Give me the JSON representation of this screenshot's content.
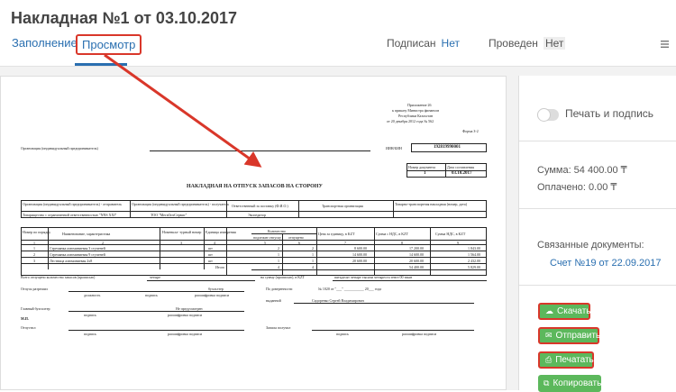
{
  "header": {
    "title": "Накладная №1 от 03.10.2017",
    "tabs": {
      "fill": "Заполнение",
      "view": "Просмотр"
    },
    "signed_label": "Подписан",
    "signed_value": "Нет",
    "posted_label": "Проведен",
    "posted_value": "Нет"
  },
  "side": {
    "print_sign_label": "Печать и подпись",
    "sum_text": "Сумма: 54 400.00 ₸",
    "paid_text": "Оплачено: 0.00 ₸",
    "linked_docs_label": "Связанные документы:",
    "linked_doc": "Счет №19 от 22.09.2017",
    "buttons": {
      "download": "Скачать",
      "send": "Отправить",
      "print": "Печатать",
      "copy": "Копировать"
    }
  },
  "doc": {
    "appendix_l1": "Приложение 26",
    "appendix_l2": "к приказу Министра финансов",
    "appendix_l3": "Республики Казахстан",
    "appendix_l4": "от 20 декабря 2012 года № 562",
    "form": "Форма З-2",
    "org_label": "Организация (индивидуальный предприниматель)",
    "iin_label": "ИИН/БИН",
    "iin_value": "192819990001",
    "doc_num_label": "Номер документа",
    "doc_date_label": "Дата составления",
    "doc_num": "1",
    "doc_date": "03.10.2017",
    "doc_title": "НАКЛАДНАЯ НА ОТПУСК ЗАПАСОВ НА СТОРОНУ",
    "h_sender": "Организация (индивидуальный предприниматель) - отправитель",
    "h_receiver": "Организация (индивидуальный предприниматель) - получатель",
    "h_responsible": "Ответственный за поставку (Ф.И.О.)",
    "h_transport": "Транспортная организация",
    "h_waybill": "Товарно-транспортная накладная (номер, дата)",
    "sender": "Товарищество с ограниченной ответственностью \"NNS XXI\"",
    "receiver": "ТОО \"МегаОптСервис\"",
    "responsible": "Экспедитор",
    "col_num": "Номер по порядку",
    "col_name": "Наименование, характеристика",
    "col_nomen": "Номенкла- турный номер",
    "col_unit": "Единица измерения",
    "col_qty": "Количество",
    "col_qty_release": "подлежит отпуску",
    "col_qty_released": "отпущено",
    "col_price": "Цена за единицу, в KZT",
    "col_sum_vat": "Сумма с НДС, в KZT",
    "col_vat": "Сумма НДС, в KZT",
    "col_idx": [
      "1",
      "2",
      "3",
      "4",
      "5",
      "6",
      "7",
      "8",
      "9"
    ],
    "rows": [
      {
        "n": "1",
        "name": "Стремянка алюминиевая 3 ступеней",
        "unit": "шт",
        "q1": "2",
        "q2": "2",
        "price": "8 600.00",
        "sum": "17 200.00",
        "vat": "1 843.00"
      },
      {
        "n": "2",
        "name": "Стремянка алюминиевая 9 ступеней",
        "unit": "шт",
        "q1": "1",
        "q2": "1",
        "price": "14 600.00",
        "sum": "14 600.00",
        "vat": "1 564.00"
      },
      {
        "n": "3",
        "name": "Лестница алюминиевая 2x8",
        "unit": "шт",
        "q1": "1",
        "q2": "1",
        "price": "20 600.00",
        "sum": "20 600.00",
        "vat": "2 432.00"
      }
    ],
    "total_label": "Итого",
    "total_q1": "4",
    "total_q2": "4",
    "total_sum": "54 400.00",
    "total_vat": "5 829.00",
    "released_total_label": "Всего отпущено количество запасов (прописью)",
    "released_total": "четыре",
    "sum_words_label": "на сумму (прописью), в KZT",
    "sum_words": "пятьдесят четыре тысячи четыреста тенге 00 тиын",
    "release_permitted": "Отпуск разрешил",
    "accountant_word": "бухгалтер",
    "position": "должность",
    "signature": "подпись",
    "decoding": "расшифровка подписи",
    "proxy_label": "По доверенности",
    "proxy_text": "№ 1020 от \"___\" ___________ 20___ года",
    "issued_label": "выданной",
    "issued_to": "Сидоренко Сергей Владимирович",
    "chief_accountant": "Главный бухгалтер",
    "not_provided": "Не предусмотрен",
    "mp": "М.П.",
    "released_label": "Отпустил",
    "received_label": "Запасы получил"
  }
}
